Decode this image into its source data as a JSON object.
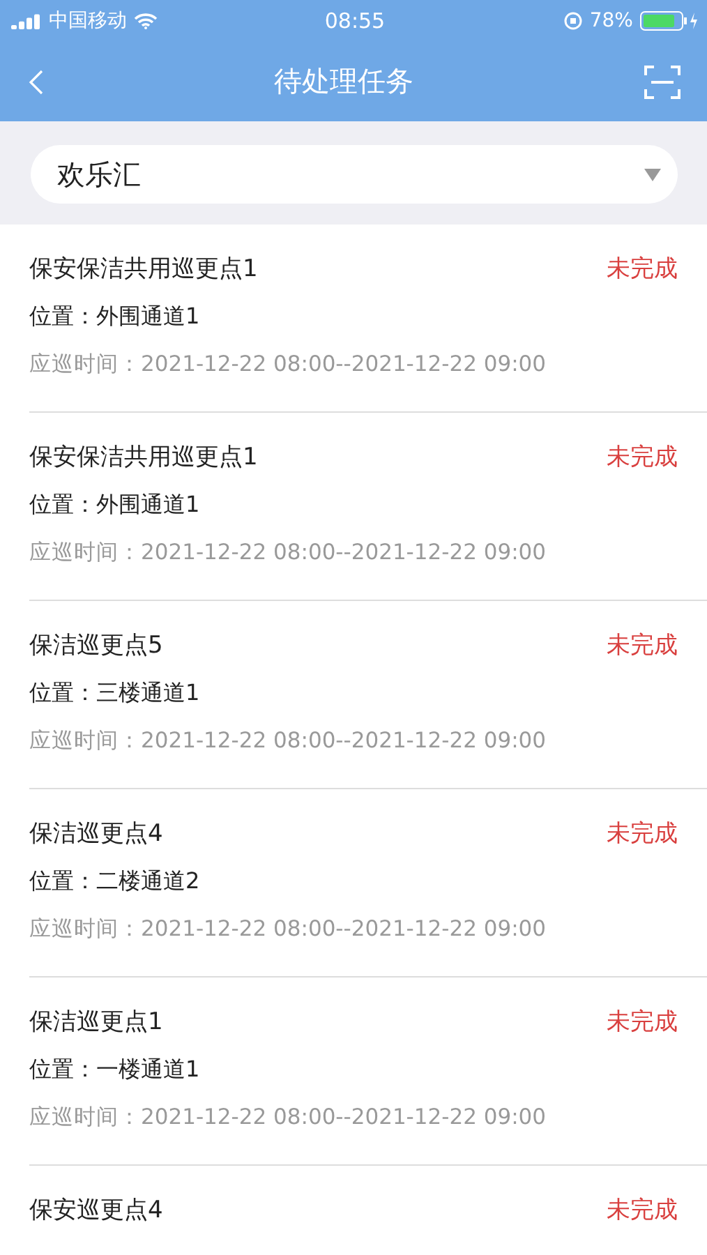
{
  "status_bar": {
    "carrier": "中国移动",
    "time": "08:55",
    "battery": "78%"
  },
  "header": {
    "title": "待处理任务"
  },
  "filter": {
    "value": "欢乐汇"
  },
  "tasks": [
    {
      "name": "保安保洁共用巡更点1",
      "status": "未完成",
      "location": "位置：外围通道1",
      "time": "应巡时间：2021-12-22 08:00--2021-12-22 09:00"
    },
    {
      "name": "保安保洁共用巡更点1",
      "status": "未完成",
      "location": "位置：外围通道1",
      "time": "应巡时间：2021-12-22 08:00--2021-12-22 09:00"
    },
    {
      "name": "保洁巡更点5",
      "status": "未完成",
      "location": "位置：三楼通道1",
      "time": "应巡时间：2021-12-22 08:00--2021-12-22 09:00"
    },
    {
      "name": "保洁巡更点4",
      "status": "未完成",
      "location": "位置：二楼通道2",
      "time": "应巡时间：2021-12-22 08:00--2021-12-22 09:00"
    },
    {
      "name": "保洁巡更点1",
      "status": "未完成",
      "location": "位置：一楼通道1",
      "time": "应巡时间：2021-12-22 08:00--2021-12-22 09:00"
    },
    {
      "name": "保安巡更点4",
      "status": "未完成"
    }
  ]
}
